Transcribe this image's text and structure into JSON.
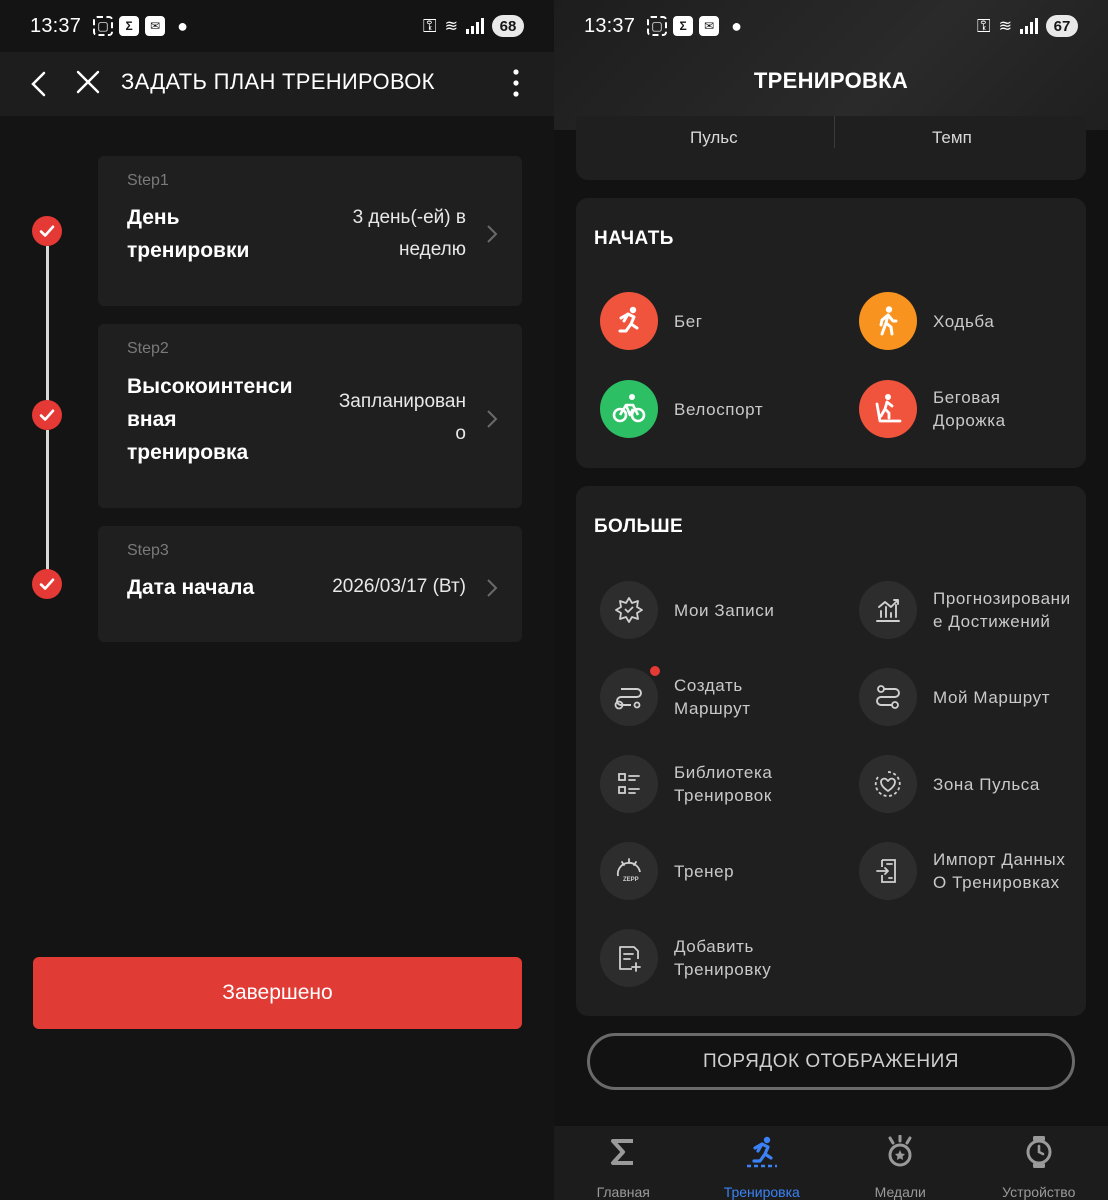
{
  "left_screen": {
    "status_bar": {
      "time": "13:37",
      "battery": "68"
    },
    "header": {
      "title": "ЗАДАТЬ ПЛАН ТРЕНИРОВОК"
    },
    "steps": [
      {
        "label": "Step1",
        "title_lines": [
          "День",
          "тренировки"
        ],
        "value_lines": [
          "3 день(-ей) в",
          "неделю"
        ]
      },
      {
        "label": "Step2",
        "title_lines": [
          "Высокоинтенси",
          "вная",
          "тренировка"
        ],
        "value_lines": [
          "Запланирован",
          "о"
        ]
      },
      {
        "label": "Step3",
        "title_lines": [
          "Дата начала"
        ],
        "value_lines": [
          "2026/03/17 (Вт)"
        ]
      }
    ],
    "done_button": "Завершено"
  },
  "right_screen": {
    "status_bar": {
      "time": "13:37",
      "battery": "67"
    },
    "header": {
      "title": "ТРЕНИРОВКА"
    },
    "top_tabs": [
      "Пульс",
      "Темп"
    ],
    "start_section": {
      "title": "НАЧАТЬ",
      "items": [
        {
          "label_lines": [
            "Бег"
          ],
          "icon": "running-icon",
          "color": "#F0543C"
        },
        {
          "label_lines": [
            "Ходьба"
          ],
          "icon": "walking-icon",
          "color": "#F7931E"
        },
        {
          "label_lines": [
            "Велоспорт"
          ],
          "icon": "cycling-icon",
          "color": "#2DBF64"
        },
        {
          "label_lines": [
            "Беговая",
            "Дорожка"
          ],
          "icon": "treadmill-icon",
          "color": "#F0543C"
        }
      ]
    },
    "more_section": {
      "title": "БОЛЬШЕ",
      "items": [
        {
          "label_lines": [
            "Мои Записи"
          ],
          "icon": "records-icon"
        },
        {
          "label_lines": [
            "Прогнозировани",
            "е Достижений"
          ],
          "icon": "prediction-chart-icon"
        },
        {
          "label_lines": [
            "Создать",
            "Маршрут"
          ],
          "icon": "create-route-icon"
        },
        {
          "label_lines": [
            "Мой Маршрут"
          ],
          "icon": "route-icon"
        },
        {
          "label_lines": [
            "Библиотека",
            "Тренировок"
          ],
          "icon": "library-icon"
        },
        {
          "label_lines": [
            "Зона Пульса"
          ],
          "icon": "heart-zone-icon"
        },
        {
          "label_lines": [
            "Тренер"
          ],
          "icon": "zepp-coach-icon"
        },
        {
          "label_lines": [
            "Импорт Данных",
            "О Тренировках"
          ],
          "icon": "import-icon"
        },
        {
          "label_lines": [
            "Добавить",
            "Тренировку"
          ],
          "icon": "add-workout-icon"
        }
      ]
    },
    "order_button": "ПОРЯДОК ОТОБРАЖЕНИЯ",
    "bottom_nav": [
      {
        "label": "Главная",
        "icon": "home-sigma-icon",
        "active": false
      },
      {
        "label": "Тренировка",
        "icon": "workout-run-icon",
        "active": true
      },
      {
        "label": "Медали",
        "icon": "medal-icon",
        "active": false
      },
      {
        "label": "Устройство",
        "icon": "watch-icon",
        "active": false
      }
    ],
    "colors": {
      "accent_red": "#E13B35",
      "nav_active": "#3B82F6"
    }
  }
}
